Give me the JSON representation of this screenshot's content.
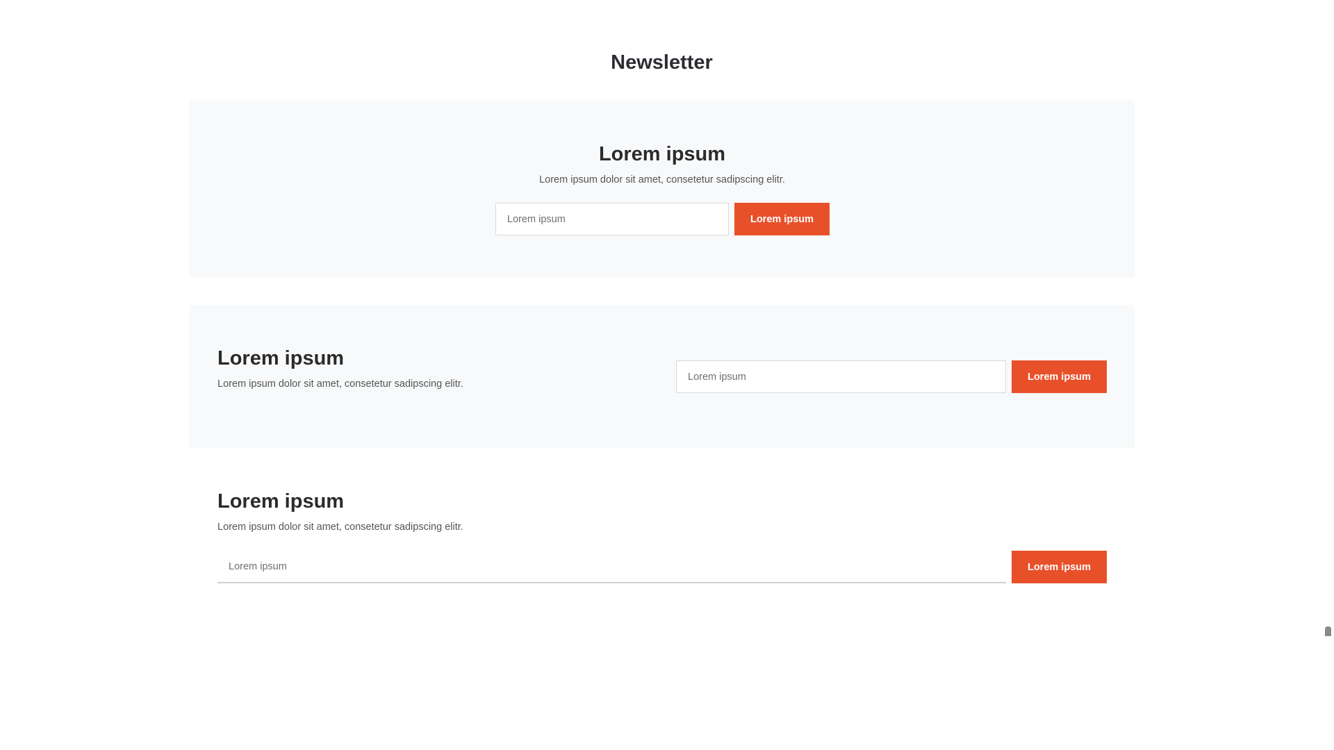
{
  "page": {
    "title": "Newsletter"
  },
  "sections": [
    {
      "heading": "Lorem ipsum",
      "text": "Lorem ipsum dolor sit amet, consetetur sadipscing elitr.",
      "input_placeholder": "Lorem ipsum",
      "button_label": "Lorem ipsum"
    },
    {
      "heading": "Lorem ipsum",
      "text": "Lorem ipsum dolor sit amet, consetetur sadipscing elitr.",
      "input_placeholder": "Lorem ipsum",
      "button_label": "Lorem ipsum"
    },
    {
      "heading": "Lorem ipsum",
      "text": "Lorem ipsum dolor sit amet, consetetur sadipscing elitr.",
      "input_placeholder": "Lorem ipsum",
      "button_label": "Lorem ipsum"
    }
  ],
  "colors": {
    "accent": "#e8502a",
    "panel_background": "#f8f9fa",
    "heading": "#2b2b2b",
    "body_text": "#555555"
  }
}
